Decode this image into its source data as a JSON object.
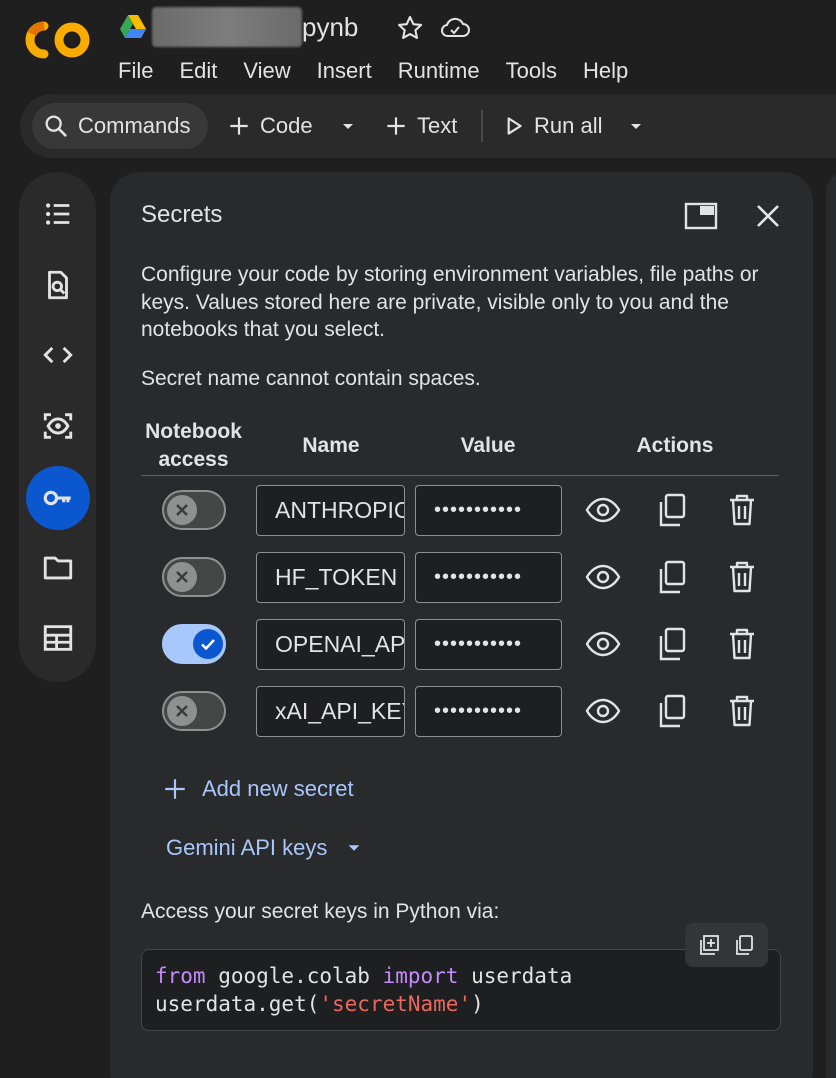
{
  "app": {
    "logo_text": "CO",
    "title_suffix": "pynb"
  },
  "menu": [
    "File",
    "Edit",
    "View",
    "Insert",
    "Runtime",
    "Tools",
    "Help"
  ],
  "toolbar": {
    "commands_label": "Commands",
    "code_label": "Code",
    "text_label": "Text",
    "run_all_label": "Run all"
  },
  "rail_icons": [
    "table-of-contents-icon",
    "find-replace-icon",
    "code-snippets-icon",
    "variables-icon",
    "secrets-key-icon",
    "files-folder-icon",
    "data-table-icon"
  ],
  "secrets_panel": {
    "title": "Secrets",
    "description": "Configure your code by storing environment variables, file paths or keys. Values stored here are private, visible only to you and the notebooks that you select.",
    "note": "Secret name cannot contain spaces.",
    "headers": {
      "notebook_access": "Notebook access",
      "name": "Name",
      "value": "Value",
      "actions": "Actions"
    },
    "secrets": [
      {
        "access": false,
        "name": "ANTHROPIC_API_KEY",
        "value": "•••••••••••"
      },
      {
        "access": false,
        "name": "HF_TOKEN",
        "value": "•••••••••••"
      },
      {
        "access": true,
        "name": "OPENAI_API_KEY",
        "value": "•••••••••••"
      },
      {
        "access": false,
        "name": "xAI_API_KEY",
        "value": "•••••••••••"
      }
    ],
    "add_secret_label": "Add new secret",
    "gemini_label": "Gemini API keys",
    "access_text": "Access your secret keys in Python via:",
    "code": {
      "kw_from": "from",
      "module": " google.colab ",
      "kw_import": "import",
      "name": " userdata",
      "line2_prefix": "userdata.get(",
      "line2_string": "'secretName'",
      "line2_suffix": ")"
    }
  },
  "colors": {
    "accent_blue": "#0b57d0",
    "link_blue": "#a8c7fa",
    "background": "#1f1f1f",
    "panel": "#282a2c",
    "logo_orange": "#f9ab00"
  }
}
